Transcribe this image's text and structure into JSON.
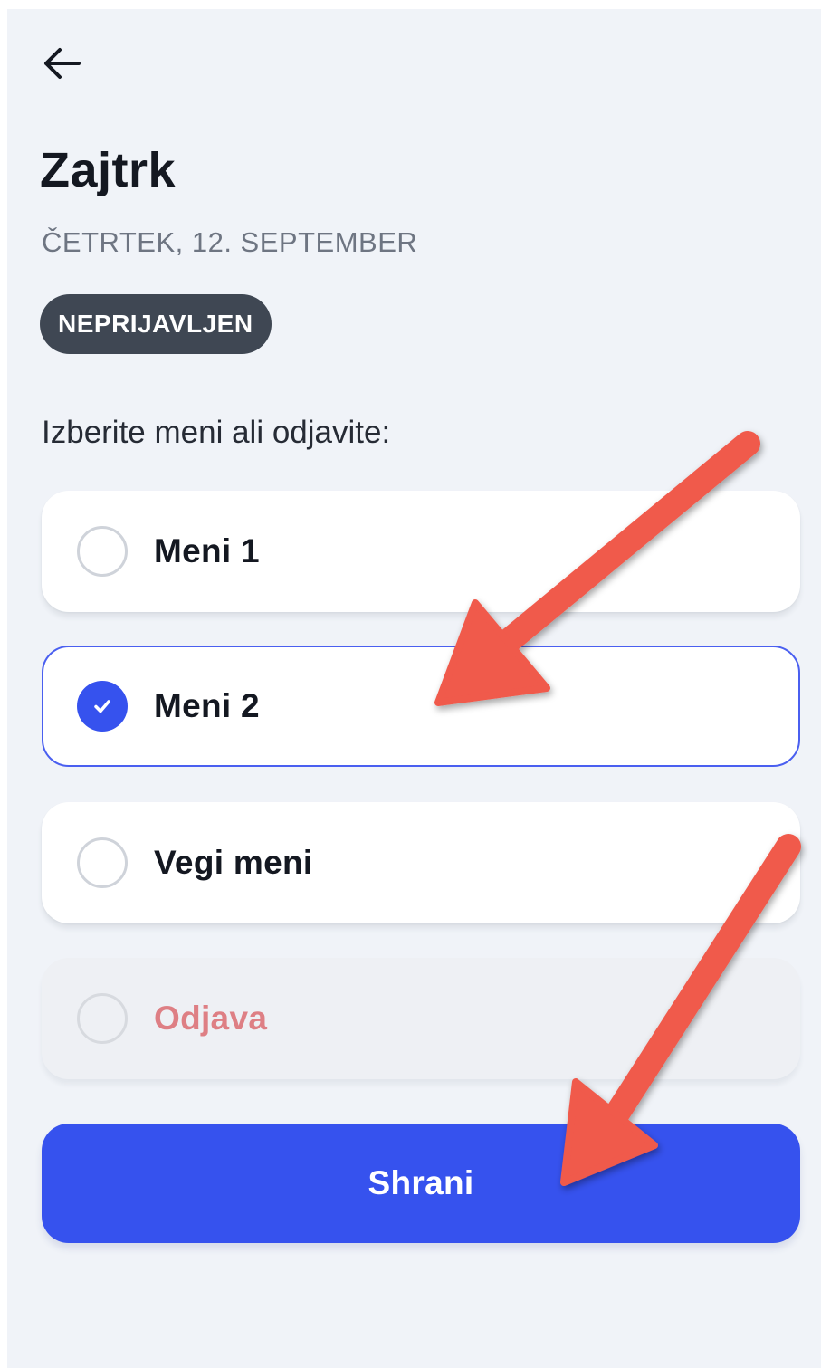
{
  "header": {
    "back_icon": "arrow-left-icon",
    "title": "Zajtrk",
    "date": "ČETRTEK, 12. SEPTEMBER",
    "status_badge": "NEPRIJAVLJEN"
  },
  "prompt": "Izberite meni ali odjavite:",
  "options": [
    {
      "label": "Meni 1",
      "selected": false
    },
    {
      "label": "Meni 2",
      "selected": true
    },
    {
      "label": "Vegi meni",
      "selected": false
    },
    {
      "label": "Odjava",
      "selected": false
    }
  ],
  "save_label": "Shrani",
  "colors": {
    "accent": "#3652ee",
    "background": "#f0f3f8",
    "badge": "#3f4753",
    "unsubscribe_text": "#de7f84",
    "annotation_arrow": "#f05a4c"
  }
}
